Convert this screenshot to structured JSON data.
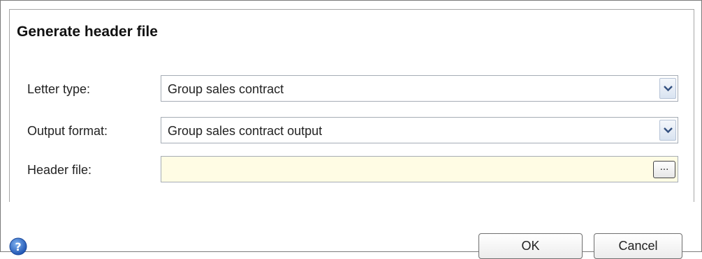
{
  "dialog": {
    "title": "Generate header file"
  },
  "form": {
    "letter_type": {
      "label": "Letter type:",
      "value": "Group sales contract",
      "dropdown_icon": "chevron-down-icon"
    },
    "output_format": {
      "label": "Output format:",
      "value": "Group sales contract output",
      "dropdown_icon": "chevron-down-icon"
    },
    "header_file": {
      "label": "Header file:",
      "value": "",
      "browse_label": "...",
      "background": "#fffce4"
    }
  },
  "footer": {
    "help_icon": "help-icon",
    "ok_label": "OK",
    "cancel_label": "Cancel"
  },
  "colors": {
    "help_blue": "#2a64c4",
    "dropdown_chevron": "#33507f",
    "field_border": "#a5acb5"
  }
}
